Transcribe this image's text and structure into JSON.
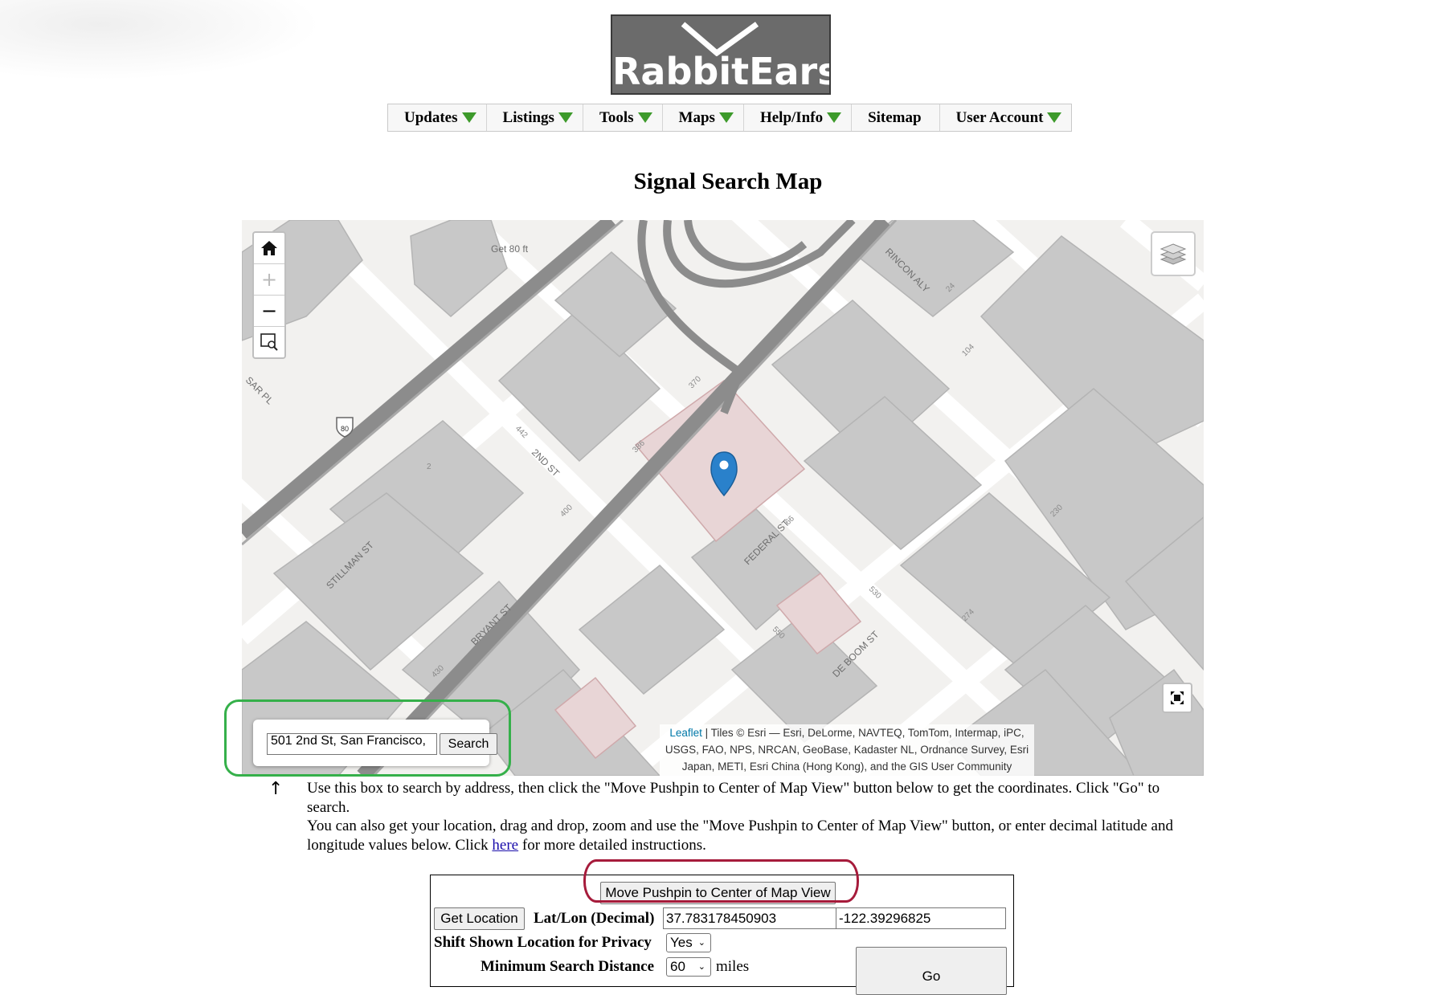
{
  "logo": {
    "text": "RabbitEars"
  },
  "nav": [
    {
      "label": "Updates",
      "dropdown": true
    },
    {
      "label": "Listings",
      "dropdown": true
    },
    {
      "label": "Tools",
      "dropdown": true
    },
    {
      "label": "Maps",
      "dropdown": true
    },
    {
      "label": "Help/Info",
      "dropdown": true
    },
    {
      "label": "Sitemap",
      "dropdown": false
    },
    {
      "label": "User Account",
      "dropdown": true
    }
  ],
  "page_title": "Signal Search Map",
  "map": {
    "zoom_in": "+",
    "zoom_out": "−",
    "streets": [
      "2ND ST",
      "BRYANT ST",
      "STILLMAN ST",
      "FEDERAL ST",
      "DE BOOM ST",
      "RINCON ALY",
      "SAR PL"
    ],
    "highway_shield": "80",
    "elevation_label": "Get 80 ft",
    "address_numbers": [
      "442",
      "386",
      "370",
      "400",
      "430",
      "550",
      "530",
      "274",
      "230",
      "104",
      "24",
      "66",
      "2"
    ],
    "attribution": {
      "link": "Leaflet",
      "text": " | Tiles © Esri — Esri, DeLorme, NAVTEQ, TomTom, Intermap, iPC, USGS, FAO, NPS, NRCAN, GeoBase, Kadaster NL, Ordnance Survey, Esri Japan, METI, Esri China (Hong Kong), and the GIS User Community"
    },
    "search": {
      "value": "501 2nd St, San Francisco,",
      "button": "Search"
    },
    "pushpin_color": "#2a81cb"
  },
  "instructions": {
    "arrow": "↑",
    "line1": "Use this box to search by address, then click the \"Move Pushpin to Center of Map View\" button below to get the coordinates. Click \"Go\" to search.",
    "line2_a": "You can also get your location, drag and drop, zoom and use the \"Move Pushpin to Center of Map View\" button, or enter decimal latitude and longitude values below. Click ",
    "link": "here",
    "line2_b": " for more detailed instructions."
  },
  "form": {
    "move_pushpin_button": "Move Pushpin to Center of Map View",
    "get_location_button": "Get Location",
    "latlon_label": "Lat/Lon (Decimal)",
    "lat_value": "37.783178450903",
    "lon_value": "-122.39296825",
    "privacy_label": "Shift Shown Location for Privacy",
    "privacy_value": "Yes",
    "distance_label": "Minimum Search Distance",
    "distance_value": "60",
    "distance_unit": "miles",
    "go_button": "Go"
  }
}
